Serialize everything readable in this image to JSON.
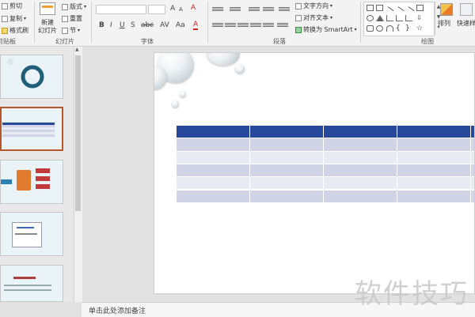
{
  "ribbon": {
    "clipboard": {
      "cut": "剪切",
      "copy": "复制",
      "format_painter": "格式刷",
      "group": "剪贴板"
    },
    "slides": {
      "new_slide_line1": "新建",
      "new_slide_line2": "幻灯片",
      "layout": "版式",
      "reset": "重置",
      "section": "节",
      "group": "幻灯片"
    },
    "font": {
      "group": "字体"
    },
    "paragraph": {
      "text_direction": "文字方向",
      "align_text": "对齐文本",
      "convert_smartart": "转换为 SmartArt",
      "group": "段落"
    },
    "drawing": {
      "arrange": "排列",
      "quick_styles": "快速样式",
      "group": "绘图"
    }
  },
  "notes": {
    "placeholder": "单击此处添加备注"
  },
  "watermark": "软件技巧",
  "table": {
    "cols": 5,
    "rows": 6,
    "header_color": "#27479b",
    "band_color": "#d0d4e6",
    "alt_color": "#e9ebf3"
  }
}
